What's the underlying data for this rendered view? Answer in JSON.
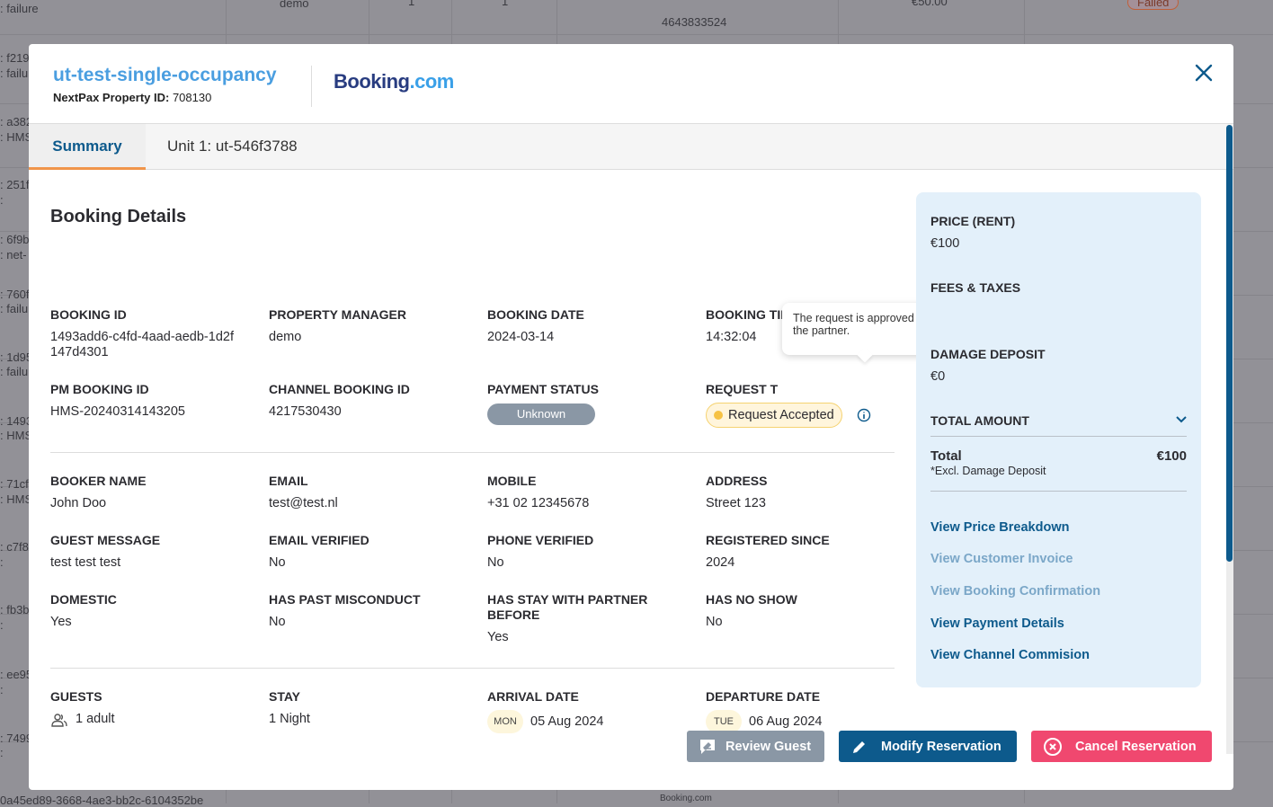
{
  "background": {
    "snippets": [
      ": failure",
      "demo",
      "1",
      "1",
      "4643833524",
      "€50.00",
      "Failed",
      ": f219c",
      ": failu",
      ": a382",
      ": HMS",
      ": 251f4",
      ":",
      ": 6f9b",
      ": net-",
      ": 760f",
      ": failu",
      ": 1d95",
      ": failu",
      ": 1493",
      ": HMS",
      ": 71cfc",
      ": HMS",
      ": c7f8",
      ":",
      ": fb3b",
      ":",
      ": ee95",
      ":",
      ": 7499",
      ":",
      "0a45ed89-3668-4ae3-bb2c-6104352be",
      "Booking.com"
    ]
  },
  "header": {
    "property_name": "ut-test-single-occupancy",
    "property_id_label": "NextPax Property ID:",
    "property_id": "708130",
    "channel_logo": {
      "part1": "Booking",
      "part2": ".com"
    },
    "close_icon": "close-icon"
  },
  "tabs": [
    {
      "label": "Summary",
      "active": true
    },
    {
      "label": "Unit 1: ut-546f3788",
      "active": false
    }
  ],
  "booking_details": {
    "title": "Booking Details",
    "fields": [
      {
        "label": "Booking ID",
        "value": "1493add6-c4fd-4aad-aedb-1d2f147d4301"
      },
      {
        "label": "Property Manager",
        "value": "demo"
      },
      {
        "label": "Booking Date",
        "value": "2024-03-14"
      },
      {
        "label": "Booking Time",
        "value": "14:32:04"
      },
      {
        "label": "PM Booking ID",
        "value": "HMS-20240314143205"
      },
      {
        "label": "Channel Booking ID",
        "value": "4217530430"
      },
      {
        "label": "Payment Status",
        "value": "Unknown"
      },
      {
        "label": "Request T",
        "value": "Request Accepted"
      },
      {
        "label": "Booker Name",
        "value": "John Doo"
      },
      {
        "label": "Email",
        "value": "test@test.nl"
      },
      {
        "label": "Mobile",
        "value": "+31 02 12345678"
      },
      {
        "label": "Address",
        "value": "Street 123"
      },
      {
        "label": "Guest Message",
        "value": "test test test"
      },
      {
        "label": "Email Verified",
        "value": "No"
      },
      {
        "label": "Phone Verified",
        "value": "No"
      },
      {
        "label": "Registered Since",
        "value": "2024"
      },
      {
        "label": "Domestic",
        "value": "Yes"
      },
      {
        "label": "Has Past Misconduct",
        "value": "No"
      },
      {
        "label": "Has Stay With Partner Before",
        "value": "Yes"
      },
      {
        "label": "Has No Show",
        "value": "No"
      },
      {
        "label": "Guests",
        "value": "1 adult"
      },
      {
        "label": "Stay",
        "value": "1 Night"
      },
      {
        "label": "Arrival Date",
        "value": "05 Aug 2024",
        "day": "MON"
      },
      {
        "label": "Departure Date",
        "value": "06 Aug 2024",
        "day": "TUE"
      }
    ],
    "tooltip": "The request is approved by the partner."
  },
  "price_panel": {
    "rent_label": "PRICE (RENT)",
    "rent": "€100",
    "fees_label": "FEES & TAXES",
    "deposit_label": "DAMAGE DEPOSIT",
    "deposit": "€0",
    "total_amount_label": "TOTAL AMOUNT",
    "total_label": "Total",
    "total": "€100",
    "total_note": "*Excl. Damage Deposit",
    "links": [
      {
        "label": "View Price Breakdown",
        "enabled": true
      },
      {
        "label": "View Customer Invoice",
        "enabled": false
      },
      {
        "label": "View Booking Confirmation",
        "enabled": false
      },
      {
        "label": "View Payment Details",
        "enabled": true
      },
      {
        "label": "View Channel Commision",
        "enabled": true
      }
    ]
  },
  "actions": {
    "review": "Review Guest",
    "modify": "Modify Reservation",
    "cancel": "Cancel Reservation"
  },
  "colors": {
    "primary": "#0d5a8c",
    "accent": "#f0954a",
    "danger": "#f0486f",
    "muted": "#8a97a5",
    "panel": "#e3f0fa",
    "title": "#4a9ee0"
  }
}
